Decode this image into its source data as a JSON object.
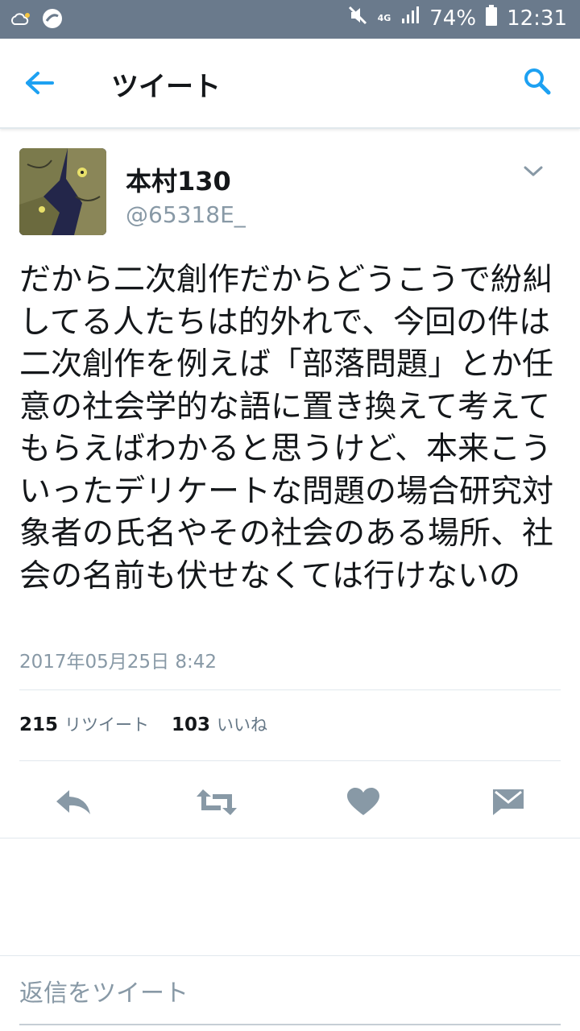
{
  "status_bar": {
    "network": "4G",
    "battery": "74%",
    "time": "12:31"
  },
  "appbar": {
    "title": "ツイート"
  },
  "tweet": {
    "display_name": "本村130",
    "handle": "@65318E_",
    "text": "だから二次創作だからどうこうで紛糾してる人たちは的外れで、今回の件は二次創作を例えば「部落問題」とか任意の社会学的な語に置き換えて考えてもらえばわかると思うけど、本来こういったデリケートな問題の場合研究対象者の氏名やその社会のある場所、社会の名前も伏せなくては行けないの",
    "timestamp": "2017年05月25日 8:42",
    "retweet_count": "215",
    "retweet_label": "リツイート",
    "like_count": "103",
    "like_label": "いいね"
  },
  "reply": {
    "placeholder": "返信をツイート"
  },
  "colors": {
    "accent": "#1da1f2",
    "icon_gray": "#8899a6",
    "status_bar": "#6a7a8c"
  }
}
